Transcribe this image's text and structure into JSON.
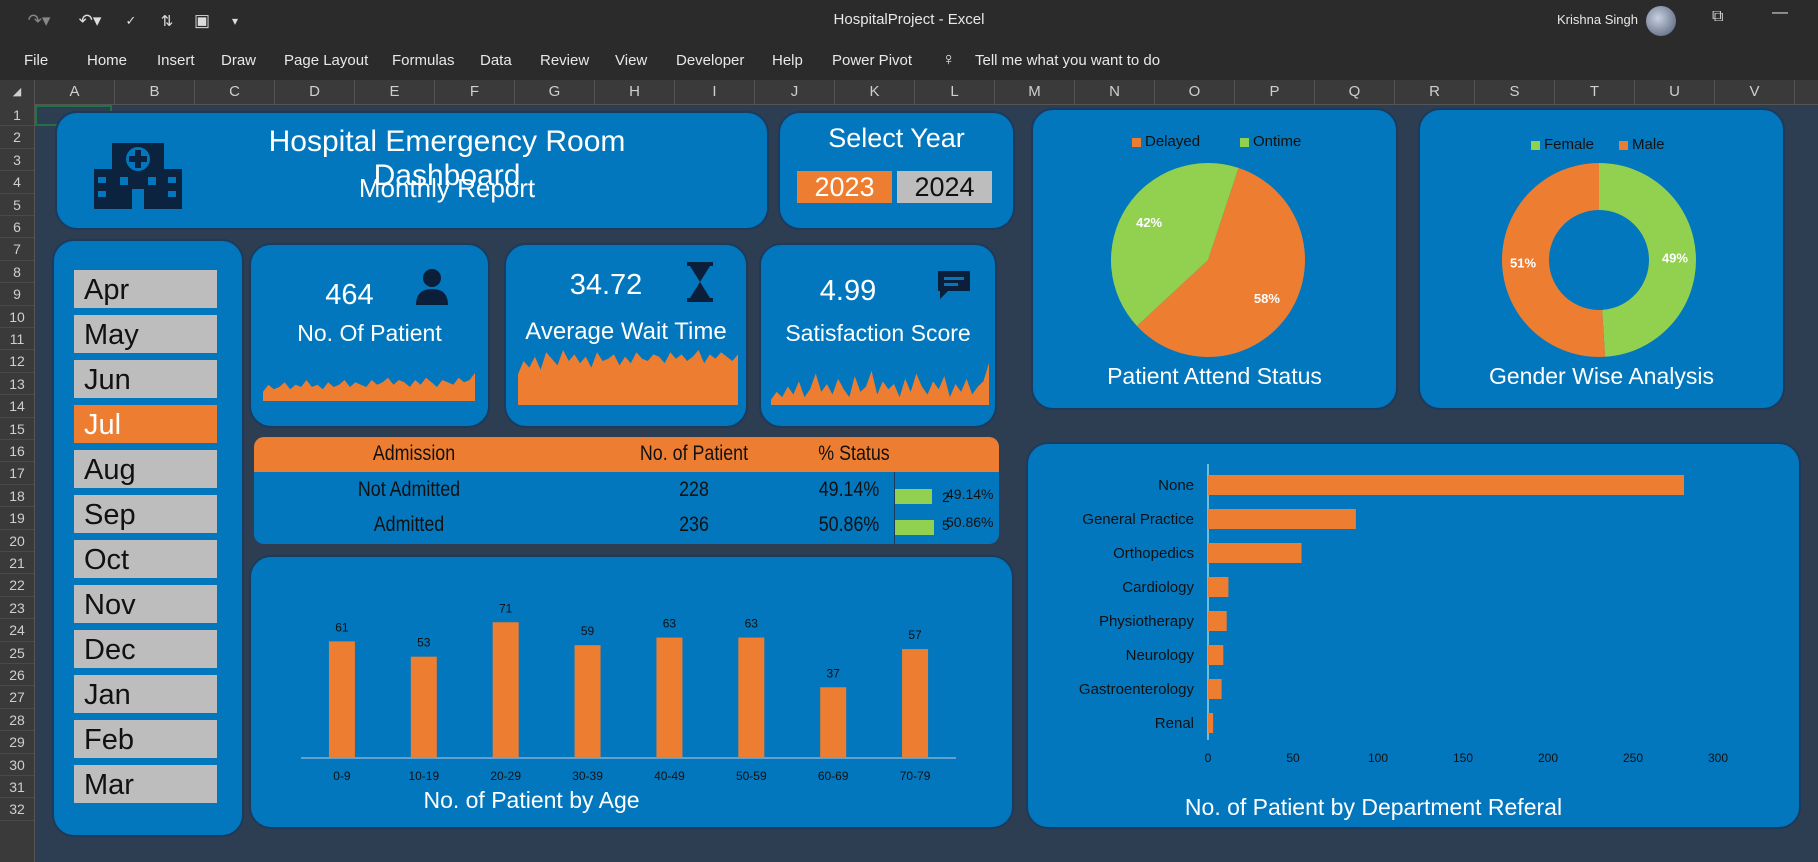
{
  "window": {
    "title": "HospitalProject  -  Excel",
    "user_name": "Krishna Singh"
  },
  "ribbon": {
    "tabs": [
      "File",
      "Home",
      "Insert",
      "Draw",
      "Page Layout",
      "Formulas",
      "Data",
      "Review",
      "View",
      "Developer",
      "Help",
      "Power Pivot"
    ],
    "tell_me": "Tell me what you want to do"
  },
  "grid": {
    "columns": [
      "A",
      "B",
      "C",
      "D",
      "E",
      "F",
      "G",
      "H",
      "I",
      "J",
      "K",
      "L",
      "M",
      "N",
      "O",
      "P",
      "Q",
      "R",
      "S",
      "T",
      "U",
      "V"
    ],
    "rows": [
      "1",
      "2",
      "3",
      "4",
      "5",
      "6",
      "7",
      "8",
      "9",
      "10",
      "11",
      "12",
      "13",
      "14",
      "15",
      "16",
      "17",
      "18",
      "19",
      "20",
      "21",
      "22",
      "23",
      "24",
      "25",
      "26",
      "27",
      "28",
      "29",
      "30",
      "31",
      "32"
    ]
  },
  "header": {
    "title": "Hospital Emergency Room Dashboard",
    "subtitle": "Monthly Report"
  },
  "year_selector": {
    "label": "Select Year",
    "years": [
      "2023",
      "2024"
    ],
    "selected": "2023"
  },
  "months": {
    "items": [
      "Apr",
      "May",
      "Jun",
      "Jul",
      "Aug",
      "Sep",
      "Oct",
      "Nov",
      "Dec",
      "Jan",
      "Feb",
      "Mar"
    ],
    "selected": "Jul"
  },
  "kpis": {
    "patients": {
      "value": "464",
      "label": "No. Of Patient"
    },
    "wait_time": {
      "value": "34.72",
      "label": "Average Wait Time"
    },
    "satisfaction": {
      "value": "4.99",
      "label": "Satisfaction Score"
    }
  },
  "admission_table": {
    "headers": [
      "Admission",
      "No. of Patient",
      "% Status"
    ],
    "rows": [
      {
        "admission": "Not Admitted",
        "patients": "228",
        "status": "49.14%",
        "bar_label": "49.14%",
        "bar_fraction": 0.4914
      },
      {
        "admission": "Admitted",
        "patients": "236",
        "status": "50.86%",
        "bar_label": "50.86%",
        "bar_fraction": 0.5086
      }
    ],
    "overlay_marks": [
      "2",
      "5"
    ]
  },
  "attend_chart": {
    "title": "Patient Attend Status",
    "legend": [
      "Delayed",
      "Ontime"
    ],
    "colors": {
      "Delayed": "#ed7d31",
      "Ontime": "#92d050"
    }
  },
  "gender_chart": {
    "title": "Gender Wise Analysis",
    "legend": [
      "Female",
      "Male"
    ],
    "colors": {
      "Female": "#92d050",
      "Male": "#ed7d31"
    }
  },
  "age_chart": {
    "title": "No. of Patient by Age"
  },
  "dept_chart": {
    "title": "No. of  Patient by Department Referal"
  },
  "colors": {
    "accent": "#ed7d31",
    "card": "#0277bd",
    "green": "#92d050",
    "sheet": "#2d3e52"
  },
  "chart_data": [
    {
      "type": "pie",
      "categories": [
        "Delayed",
        "Ontime"
      ],
      "values": [
        58,
        42
      ],
      "labels": [
        "58%",
        "42%"
      ],
      "title": "Patient Attend Status",
      "legend_position": "top"
    },
    {
      "type": "pie",
      "donut": true,
      "categories": [
        "Female",
        "Male"
      ],
      "values": [
        49,
        51
      ],
      "labels": [
        "49%",
        "51%"
      ],
      "title": "Gender Wise Analysis",
      "legend_position": "top"
    },
    {
      "type": "bar",
      "categories": [
        "0-9",
        "10-19",
        "20-29",
        "30-39",
        "40-49",
        "50-59",
        "60-69",
        "70-79"
      ],
      "values": [
        61,
        53,
        71,
        59,
        63,
        63,
        37,
        57
      ],
      "title": "No. of Patient by Age",
      "ylim": [
        0,
        80
      ],
      "grid": false
    },
    {
      "type": "bar",
      "orientation": "horizontal",
      "categories": [
        "None",
        "General Practice",
        "Orthopedics",
        "Cardiology",
        "Physiotherapy",
        "Neurology",
        "Gastroenterology",
        "Renal"
      ],
      "values": [
        280,
        87,
        55,
        12,
        11,
        9,
        8,
        3
      ],
      "title": "No. of  Patient by Department Referal",
      "xlim": [
        0,
        300
      ],
      "xticks": [
        "0",
        "50",
        "100",
        "150",
        "200",
        "250",
        "300"
      ],
      "grid": false
    },
    {
      "type": "area",
      "title": "",
      "values": [
        4,
        7,
        5,
        6,
        8,
        5,
        7,
        6,
        9,
        6,
        7,
        5,
        8,
        6,
        7,
        9,
        6,
        8,
        7,
        6,
        9,
        7,
        8,
        10,
        7,
        9,
        8,
        6,
        9,
        7,
        10,
        8,
        6,
        9,
        8,
        7,
        10,
        8,
        9,
        12
      ]
    },
    {
      "type": "area",
      "title": "",
      "values": [
        14,
        20,
        17,
        22,
        16,
        24,
        21,
        18,
        25,
        20,
        23,
        19,
        22,
        17,
        24,
        20,
        21,
        23,
        18,
        22,
        19,
        24,
        21,
        20,
        23,
        22,
        19,
        24,
        21,
        23,
        20,
        22,
        25,
        19,
        23,
        21,
        24,
        22,
        20,
        23
      ]
    },
    {
      "type": "area",
      "title": "",
      "values": [
        2,
        5,
        3,
        7,
        4,
        9,
        3,
        6,
        12,
        5,
        8,
        4,
        10,
        6,
        3,
        11,
        5,
        7,
        13,
        4,
        9,
        6,
        8,
        3,
        10,
        5,
        12,
        7,
        4,
        9,
        6,
        11,
        3,
        8,
        5,
        10,
        4,
        7,
        9,
        16
      ]
    }
  ]
}
